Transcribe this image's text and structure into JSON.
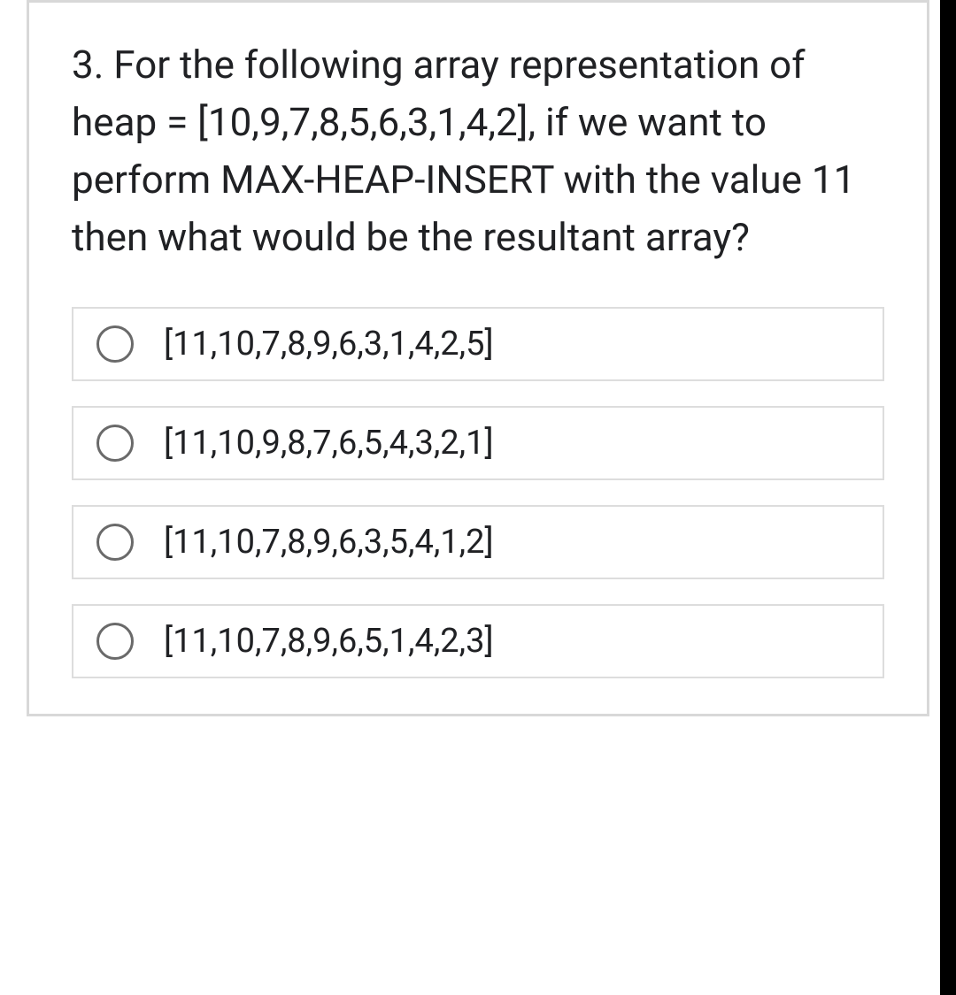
{
  "question": {
    "number": "3.",
    "text": "3. For the following array representation of heap = [10,9,7,8,5,6,3,1,4,2], if we want to perform MAX-HEAP-INSERT with the value 11 then what would be the resultant array?"
  },
  "options": [
    {
      "label": "[11,10,7,8,9,6,3,1,4,2,5]"
    },
    {
      "label": "[11,10,9,8,7,6,5,4,3,2,1]"
    },
    {
      "label": "[11,10,7,8,9,6,3,5,4,1,2]"
    },
    {
      "label": "[11,10,7,8,9,6,5,1,4,2,3]"
    }
  ]
}
